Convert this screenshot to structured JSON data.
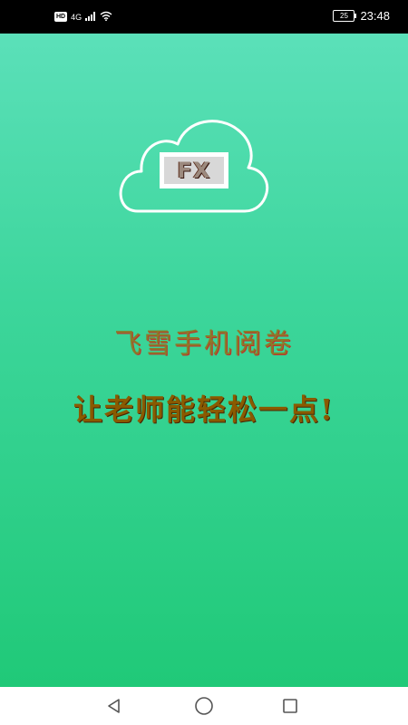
{
  "status_bar": {
    "hd_label": "HD",
    "network_label": "4G",
    "battery_level": "25",
    "time": "23:48"
  },
  "splash": {
    "logo_text": "FX",
    "app_name": "飞雪手机阅卷",
    "tagline": "让老师能轻松一点!"
  },
  "colors": {
    "gradient_top": "#5be0b9",
    "gradient_bottom": "#20c978",
    "app_name": "#8b7a2a",
    "tagline": "#8a5a00"
  },
  "nav_bar": {
    "back_icon": "back-triangle-icon",
    "home_icon": "home-circle-icon",
    "recents_icon": "recents-square-icon"
  }
}
